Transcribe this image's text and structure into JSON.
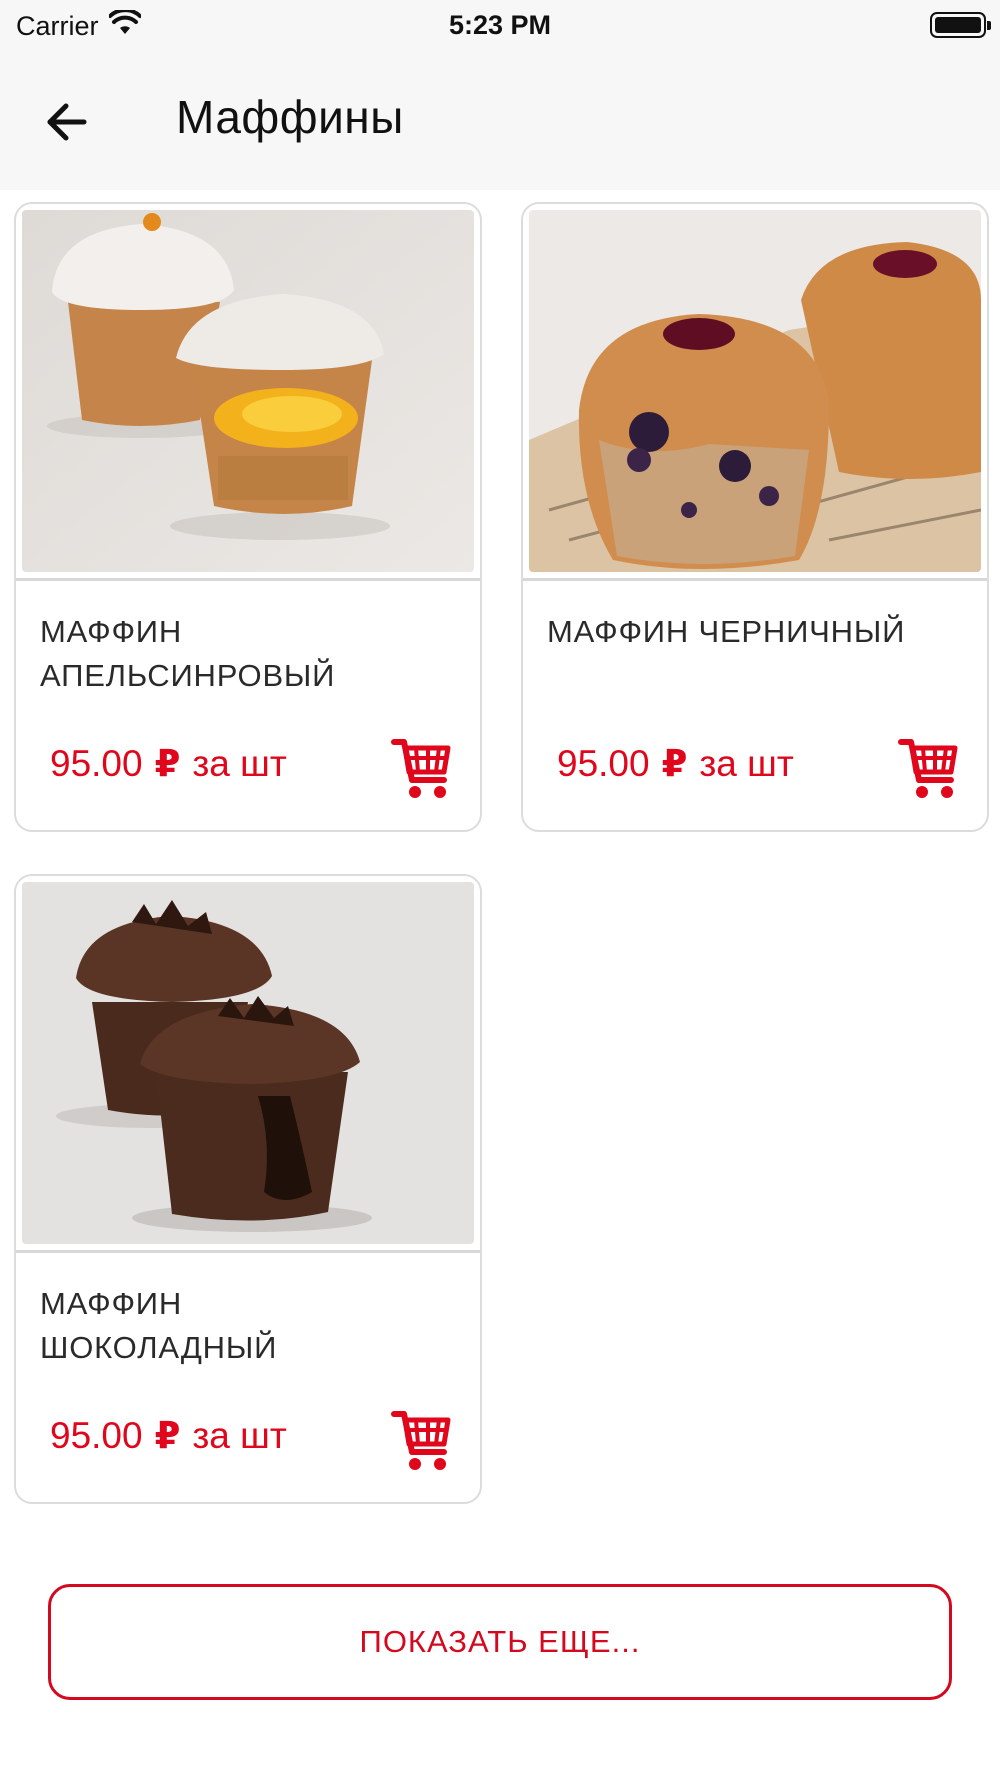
{
  "status_bar": {
    "carrier": "Carrier",
    "time": "5:23 PM"
  },
  "nav": {
    "title": "Маффины"
  },
  "products": [
    {
      "title_line1": "МАФФИН",
      "title_line2": "АПЕЛЬСИНРОВЫЙ",
      "price": "95.00",
      "currency": "₽",
      "unit": "за шт",
      "image": "orange-muffin-photo"
    },
    {
      "title_line1": "МАФФИН ЧЕРНИЧНЫЙ",
      "title_line2": "",
      "price": "95.00",
      "currency": "₽",
      "unit": "за шт",
      "image": "blueberry-muffin-photo"
    },
    {
      "title_line1": "МАФФИН",
      "title_line2": "ШОКОЛАДНЫЙ",
      "price": "95.00",
      "currency": "₽",
      "unit": "за шт",
      "image": "chocolate-muffin-photo"
    }
  ],
  "show_more": {
    "label": "ПОКАЗАТЬ ЕЩЕ..."
  },
  "colors": {
    "accent": "#e0061b",
    "nav_bg": "#f7f7f7",
    "card_border": "#dcdcdc"
  },
  "icons": [
    "wifi-icon",
    "battery-icon",
    "back-arrow-icon",
    "cart-icon"
  ]
}
